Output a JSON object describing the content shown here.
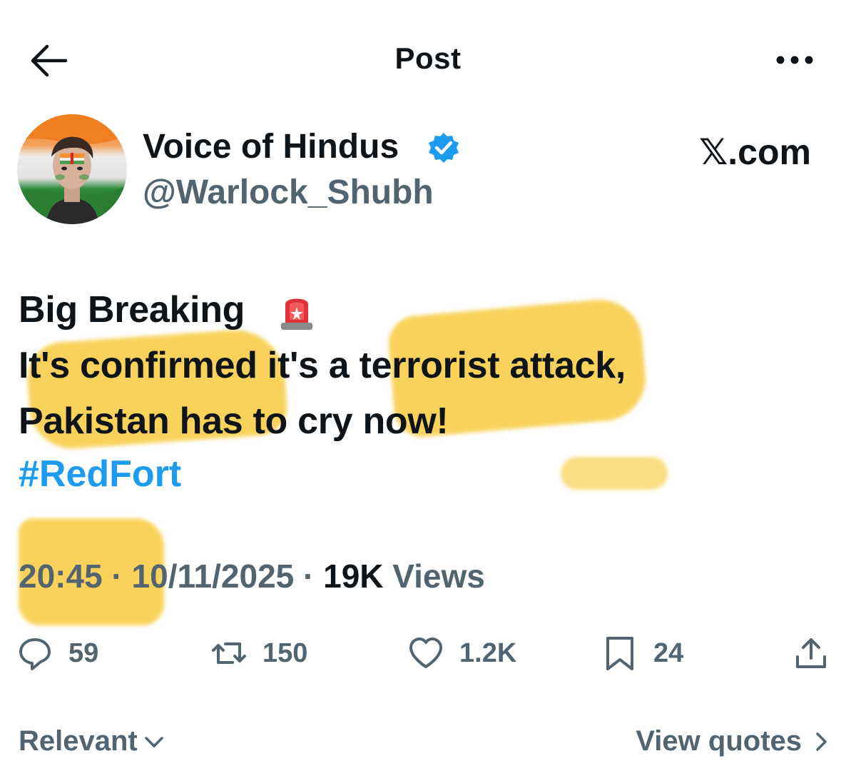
{
  "header": {
    "title": "Post",
    "back_icon": "arrow-left-icon",
    "more_icon": "more-horizontal-icon"
  },
  "author": {
    "display_name": "Voice of Hindus",
    "handle": "@Warlock_Shubh",
    "verified": true,
    "verified_color": "#1d9bf0"
  },
  "watermark": "𝕏.com",
  "post": {
    "line1": "Big Breaking",
    "line1_icon": "rotating-light-siren-icon",
    "line2": "It's confirmed it's a terrorist attack,",
    "line3": "Pakistan has to cry now!",
    "hashtag": "#RedFort"
  },
  "meta": {
    "time": "20:45",
    "separator": " · ",
    "date": "10/11/2025",
    "views_count": "19K",
    "views_label": " Views"
  },
  "actions": {
    "replies": "59",
    "reposts": "150",
    "likes": "1.2K",
    "bookmarks": "24"
  },
  "footer": {
    "sort_label": "Relevant",
    "view_quotes_label": "View quotes"
  },
  "colors": {
    "accent": "#1d9bf0",
    "text_primary": "#0f1419",
    "text_secondary": "#536471",
    "highlighter": "#f7c62e"
  }
}
